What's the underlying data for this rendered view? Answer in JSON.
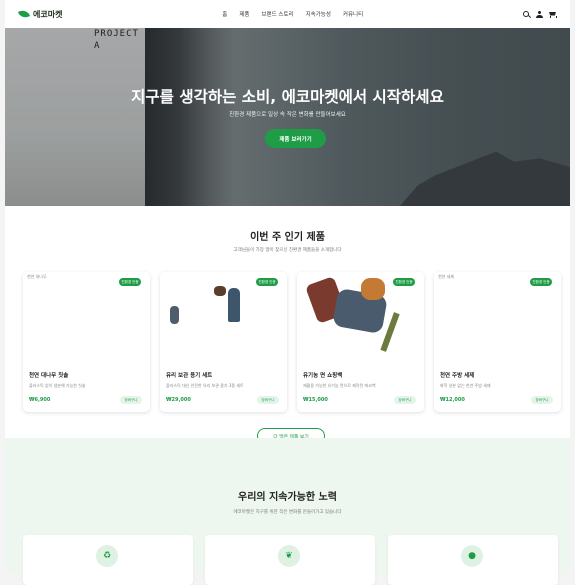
{
  "header": {
    "brand": "에코마켓",
    "nav": [
      "홈",
      "제품",
      "브랜드 스토리",
      "지속가능성",
      "커뮤니티"
    ]
  },
  "hero": {
    "title": "지구를 생각하는 소비, 에코마켓에서 시작하세요",
    "subtitle": "친환경 제품으로 일상 속 작은 변화를 만들어보세요",
    "cta": "제품 보러가기",
    "background_text": "PROJECT\nA"
  },
  "popular": {
    "title": "이번 주 인기 제품",
    "subtitle": "고객님들이 가장 많이 찾으신 친환경 제품들을 소개합니다",
    "more_button": "더 많은 제품 보기",
    "products": [
      {
        "alt": "천연 대나무",
        "tag": "친환경 인증",
        "name": "천연 대나무 칫솔",
        "desc": "플라스틱 없이 생분해 가능한 칫솔",
        "price": "₩6,900",
        "badge": "장바구니"
      },
      {
        "alt": "",
        "tag": "친환경 인증",
        "name": "유리 보관 용기 세트",
        "desc": "플라스틱 대신 안전한 유리 보관 용기 3종 세트",
        "price": "₩29,000",
        "badge": "장바구니"
      },
      {
        "alt": "",
        "tag": "친환경 인증",
        "name": "유기농 면 쇼핑백",
        "desc": "재활용 가능한 유기농 면으로 제작된 에코백",
        "price": "₩15,000",
        "badge": "장바구니"
      },
      {
        "alt": "천연 세제",
        "tag": "친환경 인증",
        "name": "천연 주방 세제",
        "desc": "화학 성분 없는 천연 주방 세제",
        "price": "₩12,000",
        "badge": "장바구니"
      }
    ]
  },
  "sustainability": {
    "title": "우리의 지속가능한 노력",
    "subtitle": "에코마켓은 지구를 위한 작은 변화를 만들어가고 있습니다",
    "icons": [
      "recycle-icon",
      "leaf-icon",
      "people-icon"
    ]
  },
  "colors": {
    "accent": "#1f9d46",
    "green_bg": "#eef7ef"
  }
}
